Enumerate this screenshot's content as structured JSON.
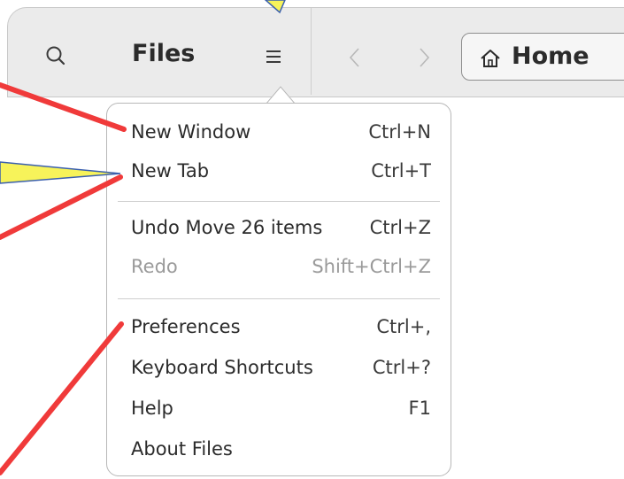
{
  "header": {
    "title": "Files",
    "search_icon": "search-icon",
    "menu_icon": "hamburger-menu-icon",
    "back_icon": "chevron-left-icon",
    "forward_icon": "chevron-right-icon",
    "location": {
      "icon": "home-icon",
      "label": "Home"
    }
  },
  "menu": {
    "groups": [
      [
        {
          "label": "New Window",
          "shortcut": "Ctrl+N",
          "enabled": true
        },
        {
          "label": "New Tab",
          "shortcut": "Ctrl+T",
          "enabled": true
        }
      ],
      [
        {
          "label": "Undo Move 26 items",
          "shortcut": "Ctrl+Z",
          "enabled": true
        },
        {
          "label": "Redo",
          "shortcut": "Shift+Ctrl+Z",
          "enabled": false
        }
      ],
      [
        {
          "label": "Preferences",
          "shortcut": "Ctrl+,",
          "enabled": true
        },
        {
          "label": "Keyboard Shortcuts",
          "shortcut": "Ctrl+?",
          "enabled": true
        },
        {
          "label": "Help",
          "shortcut": "F1",
          "enabled": true
        },
        {
          "label": "About Files",
          "shortcut": "",
          "enabled": true
        }
      ]
    ]
  },
  "colors": {
    "annotation_red": "#f03a3a",
    "annotation_yellow": "#f7f35a",
    "annotation_yellow_border": "#3a5fae",
    "header_bg": "#ebebeb",
    "disabled_text": "#9a9a9a"
  }
}
